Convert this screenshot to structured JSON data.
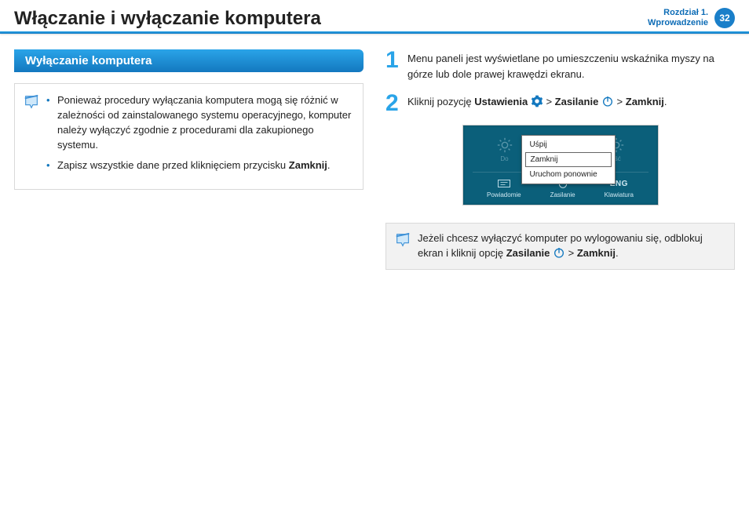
{
  "header": {
    "title": "Włączanie i wyłączanie komputera",
    "chapter_label": "Rozdział 1.",
    "chapter_subtitle": "Wprowadzenie",
    "page_number": "32"
  },
  "section_heading": "Wyłączanie komputera",
  "note_left": {
    "bullet1": "Ponieważ procedury wyłączania komputera mogą się różnić w zależności od zainstalowanego systemu operacyjnego, komputer należy wyłączyć zgodnie z procedurami dla zakupionego systemu.",
    "bullet2_a": "Zapisz wszystkie dane przed kliknięciem przycisku ",
    "bullet2_b": "Zamknij",
    "bullet2_c": "."
  },
  "steps": {
    "one": {
      "num": "1",
      "text": "Menu paneli jest wyświetlane po umieszczeniu wskaźnika myszy na górze lub dole prawej krawędzi ekranu."
    },
    "two": {
      "num": "2",
      "prefix": "Kliknij pozycję ",
      "settings": "Ustawienia",
      "sep": " > ",
      "power": "Zasilanie",
      "close": "Zamknij",
      "dot": "."
    }
  },
  "screenshot": {
    "popup": {
      "sleep": "Uśpij",
      "shutdown": "Zamknij",
      "restart": "Uruchom ponownie"
    },
    "tile_left": "Do",
    "tile_right_partial": "ość",
    "bottom": {
      "notify": "Powiadomie",
      "power": "Zasilanie",
      "keyboard": "Klawiatura",
      "eng": "ENG"
    }
  },
  "note_right": {
    "a": "Jeżeli chcesz wyłączyć komputer po wylogowaniu się, odblokuj ekran i kliknij opcję ",
    "power": "Zasilanie",
    "sep": " > ",
    "close": "Zamknij",
    "dot": "."
  }
}
